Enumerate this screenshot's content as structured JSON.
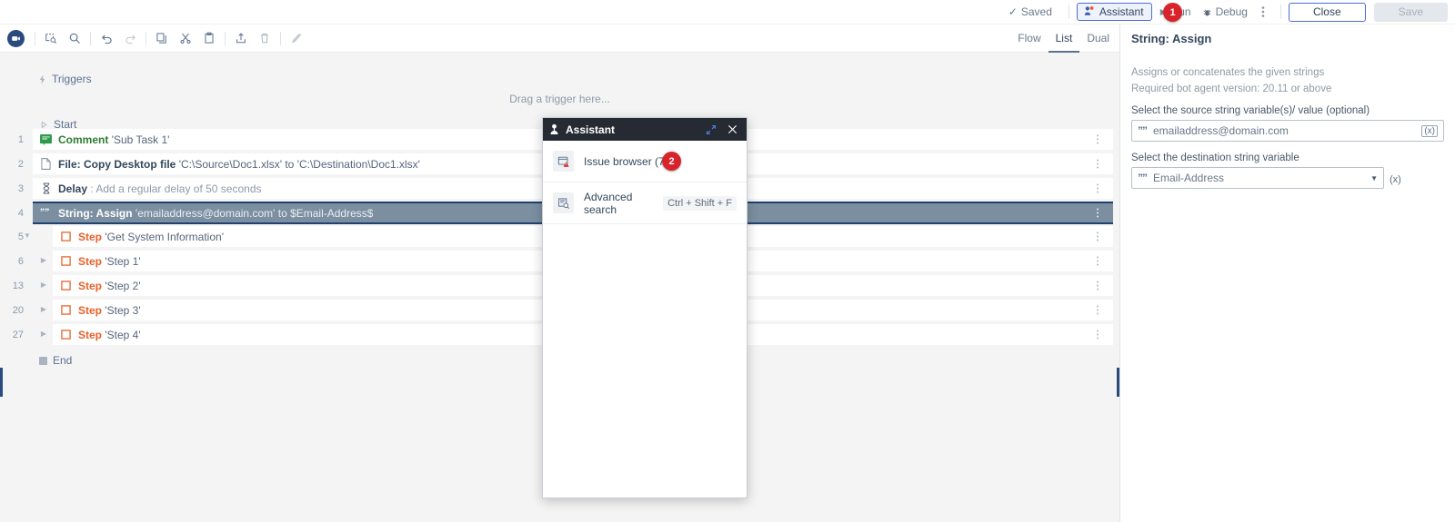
{
  "topbar": {
    "saved_label": "Saved",
    "saved_icon": "check-icon",
    "assistant_label": "Assistant",
    "assistant_icon": "assistant-robot-icon",
    "run_label": "Run",
    "run_icon": "play-icon",
    "debug_label": "Debug",
    "debug_icon": "bug-icon",
    "overflow_icon": "kebab-menu-icon",
    "close_label": "Close",
    "save_label": "Save",
    "badges": [
      {
        "id": "1",
        "text": "1"
      },
      {
        "id": "2",
        "text": "2"
      }
    ],
    "accent_blue": "#4a6fd4",
    "badge_red": "#d8232a"
  },
  "toolbar": {
    "logo_icon": "app-logo-icon",
    "buttons": [
      {
        "name": "find-replace-icon",
        "title": "Find"
      },
      {
        "name": "search-icon",
        "title": "Search"
      },
      {
        "name": "undo-icon",
        "title": "Undo"
      },
      {
        "name": "redo-icon",
        "title": "Redo"
      },
      {
        "name": "copy-icon",
        "title": "Copy"
      },
      {
        "name": "cut-icon",
        "title": "Cut"
      },
      {
        "name": "paste-icon",
        "title": "Paste"
      },
      {
        "name": "upload-icon",
        "title": "Upload"
      },
      {
        "name": "delete-icon",
        "title": "Delete"
      },
      {
        "name": "disable-icon",
        "title": "Disable"
      }
    ]
  },
  "view_tabs": [
    {
      "label": "Flow",
      "active": false
    },
    {
      "label": "List",
      "active": true
    },
    {
      "label": "Dual",
      "active": false
    }
  ],
  "canvas": {
    "triggers_label": "Triggers",
    "drag_trigger_text": "Drag a trigger here...",
    "start_label": "Start",
    "end_label": "End",
    "rows": [
      {
        "num": "1",
        "icon": "comment-icon",
        "title": "Comment",
        "detail": "'Sub Task 1'",
        "selected": false,
        "kind": "comment"
      },
      {
        "num": "2",
        "icon": "file-icon",
        "title": "File: Copy Desktop file",
        "detail": "'C:\\Source\\Doc1.xlsx' to 'C:\\Destination\\Doc1.xlsx'",
        "selected": false,
        "kind": "file"
      },
      {
        "num": "3",
        "icon": "hourglass-icon",
        "title": "Delay",
        "detail": ": Add a regular delay of 50 seconds",
        "selected": false,
        "kind": "delay"
      },
      {
        "num": "4",
        "icon": "string-quote-icon",
        "title": "String: Assign",
        "detail": "'emailaddress@domain.com' to $Email-Address$",
        "selected": true,
        "kind": "string"
      },
      {
        "num": "5",
        "icon": "step-square-icon",
        "title": "Step",
        "detail": "'Get System Information'",
        "selected": false,
        "kind": "step",
        "expanded": true
      },
      {
        "num": "6",
        "icon": "step-square-icon",
        "title": "Step",
        "detail": "'Step 1'",
        "selected": false,
        "kind": "step",
        "expanded": false
      },
      {
        "num": "13",
        "icon": "step-square-icon",
        "title": "Step",
        "detail": "'Step 2'",
        "selected": false,
        "kind": "step",
        "expanded": false
      },
      {
        "num": "20",
        "icon": "step-square-icon",
        "title": "Step",
        "detail": "'Step 3'",
        "selected": false,
        "kind": "step",
        "expanded": false
      },
      {
        "num": "27",
        "icon": "step-square-icon",
        "title": "Step",
        "detail": "'Step 4'",
        "selected": false,
        "kind": "step",
        "expanded": false
      }
    ]
  },
  "assistant_panel": {
    "title": "Assistant",
    "title_icon": "assistant-robot-icon",
    "expand_icon": "expand-diagonal-icon",
    "close_icon": "close-icon",
    "items": [
      {
        "label": "Issue browser (7)",
        "icon": "issue-browser-icon",
        "shortcut": ""
      },
      {
        "label": "Advanced search",
        "icon": "advanced-search-icon",
        "shortcut": "Ctrl + Shift + F"
      }
    ]
  },
  "properties": {
    "title": "String: Assign",
    "description": "Assigns or concatenates the given strings",
    "version_note": "Required bot agent version: 20.11 or above",
    "source": {
      "label": "Select the source string variable(s)/ value (optional)",
      "value": "emailaddress@domain.com",
      "prefix_icon": "string-quote-icon",
      "suffix_icon": "fx-variable-icon"
    },
    "destination": {
      "label": "Select the destination string variable",
      "value": "Email-Address",
      "prefix_icon": "string-quote-icon",
      "dropdown_icon": "chevron-down-icon",
      "suffix_icon": "fx-variable-icon"
    }
  }
}
